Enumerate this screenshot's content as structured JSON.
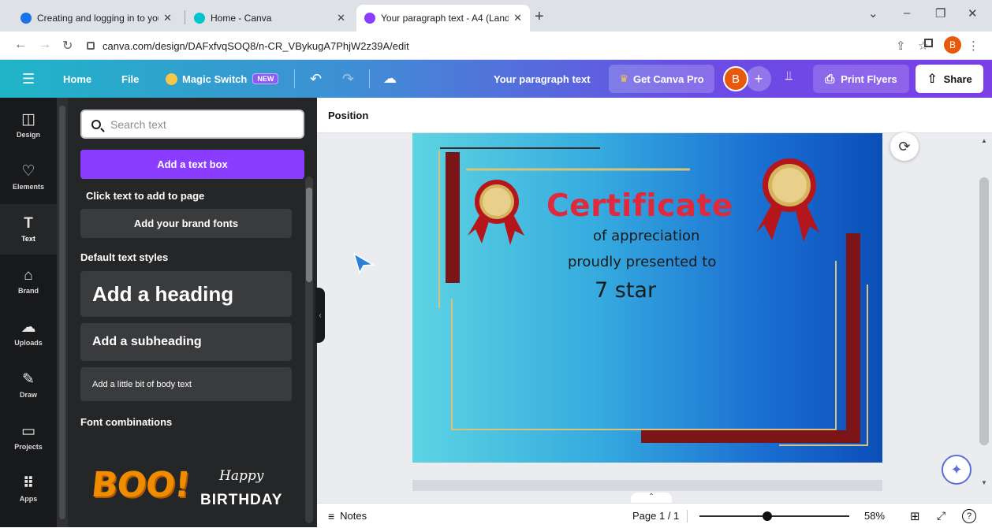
{
  "browser": {
    "tabs": [
      {
        "title": "Creating and logging in to your C",
        "favicon_color": "#1a73e8"
      },
      {
        "title": "Home - Canva",
        "favicon_color": "#00c4cc"
      },
      {
        "title": "Your paragraph text - A4 (Landsc",
        "favicon_color": "#8b3dff",
        "active": true
      }
    ],
    "new_tab_icon": "+",
    "url": "canva.com/design/DAFxfvqSOQ8/n-CR_VBykugA7PhjW2z39A/edit",
    "profile_initial": "B"
  },
  "header": {
    "home": "Home",
    "file": "File",
    "magic_switch": "Magic Switch",
    "new_badge": "NEW",
    "doc_title": "Your paragraph text",
    "get_pro": "Get Canva Pro",
    "avatar_initial": "B",
    "print": "Print Flyers",
    "share": "Share"
  },
  "rail": [
    {
      "label": "Design",
      "icon": "design-icon",
      "glyph": "◫"
    },
    {
      "label": "Elements",
      "icon": "elements-icon",
      "glyph": "♡"
    },
    {
      "label": "Text",
      "icon": "text-icon",
      "glyph": "T",
      "active": true
    },
    {
      "label": "Brand",
      "icon": "brand-icon",
      "glyph": "⌂"
    },
    {
      "label": "Uploads",
      "icon": "uploads-icon",
      "glyph": "☁"
    },
    {
      "label": "Draw",
      "icon": "draw-icon",
      "glyph": "✎"
    },
    {
      "label": "Projects",
      "icon": "projects-icon",
      "glyph": "▭"
    },
    {
      "label": "Apps",
      "icon": "apps-icon",
      "glyph": "⠿"
    }
  ],
  "panel": {
    "search_placeholder": "Search text",
    "add_text_box": "Add a text box",
    "click_hint": "Click text to add to page",
    "brand_fonts": "Add your brand fonts",
    "default_styles": "Default text styles",
    "heading": "Add a heading",
    "subheading": "Add a subheading",
    "body": "Add a little bit of body text",
    "font_combinations": "Font combinations",
    "combo1": "BOO!",
    "combo2_top": "Happy",
    "combo2_bottom": "BIRTHDAY"
  },
  "editor": {
    "toolbar_position": "Position",
    "notes": "Notes",
    "page": "Page 1 / 1",
    "zoom": "58%",
    "zoom_level": 0.58
  },
  "certificate": {
    "title": "Certificate",
    "line1": "of appreciation",
    "line2": "proudly presented to",
    "name": "7 star",
    "colors": {
      "title": "#e0293a",
      "frame": "#7c1518",
      "gold": "#d9c27a"
    }
  }
}
